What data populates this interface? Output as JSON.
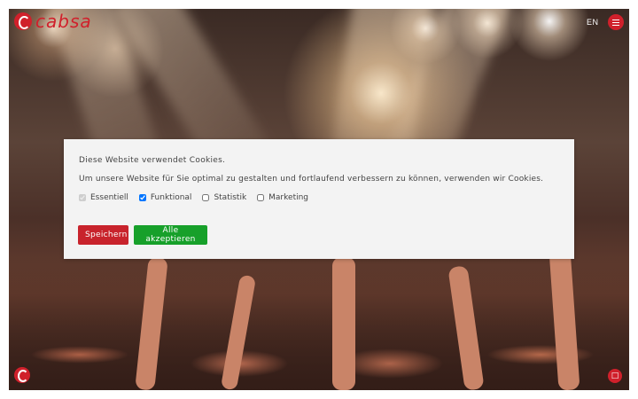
{
  "header": {
    "logo_text": "cabsa",
    "language": "EN",
    "menu_icon": "hamburger-icon"
  },
  "cookie_banner": {
    "title": "Diese Website verwendet Cookies.",
    "description": "Um unsere Website für Sie optimal zu gestalten und fortlaufend verbessern zu können, verwenden wir Cookies.",
    "options": [
      {
        "label": "Essentiell",
        "checked": true,
        "disabled": true
      },
      {
        "label": "Funktional",
        "checked": true,
        "disabled": false
      },
      {
        "label": "Statistik",
        "checked": false,
        "disabled": false
      },
      {
        "label": "Marketing",
        "checked": false,
        "disabled": false
      }
    ],
    "save_label": "Speichern",
    "accept_all_label": "Alle akzeptieren"
  },
  "colors": {
    "brand_red": "#d0202b",
    "accept_green": "#17a02a",
    "save_red": "#c8232c"
  },
  "footer": {
    "logo_icon": "cabsa-logo-icon",
    "feedback_icon": "feedback-icon"
  }
}
